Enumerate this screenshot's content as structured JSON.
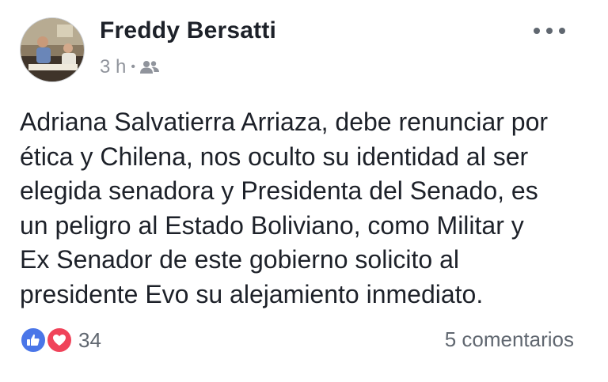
{
  "post": {
    "author": "Freddy Bersatti",
    "timestamp": "3 h",
    "separator": "•",
    "audience_icon": "friends-icon",
    "body": "Adriana Salvatierra Arriaza, debe renunciar por\nética y Chilena, nos oculto  su identidad  al ser\nelegida senadora  y Presidenta del Senado, es\nun peligro al Estado Boliviano, como Militar y\nEx Senador de este gobierno solicito al\npresidente Evo  su alejamiento inmediato.",
    "reactions": {
      "icons": [
        "like-icon",
        "love-icon"
      ],
      "count": "34"
    },
    "comments_label": "5 comentarios",
    "more_icon": "more-options-icon"
  },
  "colors": {
    "text": "#1d2129",
    "meta": "#90949c",
    "like": "#4a76e8",
    "love": "#f0435a"
  }
}
